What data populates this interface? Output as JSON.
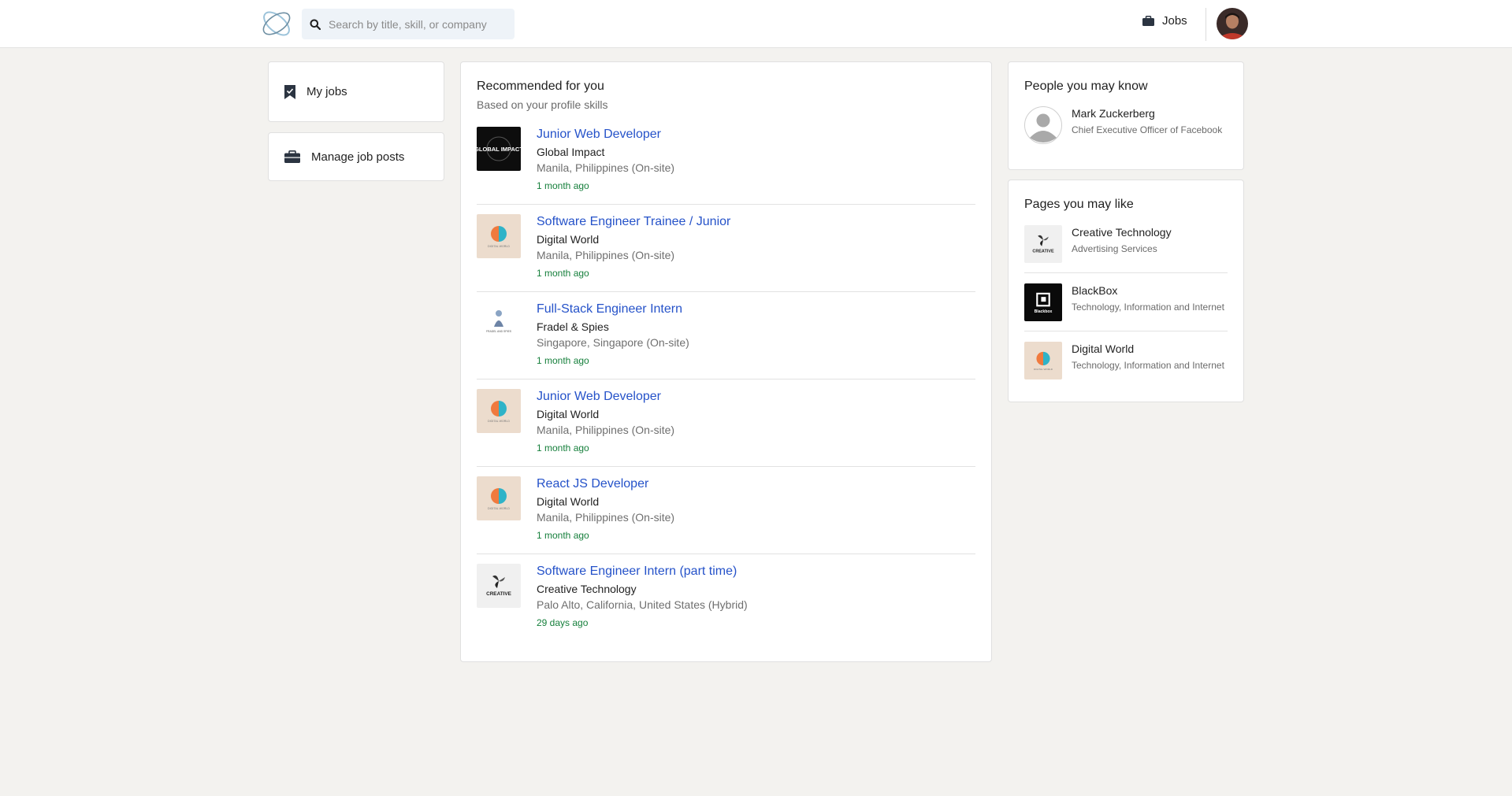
{
  "header": {
    "search_placeholder": "Search by title, skill, or company",
    "jobs_label": "Jobs"
  },
  "sidebar": {
    "my_jobs": "My jobs",
    "manage_job_posts": "Manage job posts"
  },
  "recommended": {
    "title": "Recommended for you",
    "subtitle": "Based on your profile skills",
    "jobs": [
      {
        "title": "Junior Web Developer",
        "company": "Global Impact",
        "location": "Manila, Philippines (On-site)",
        "posted": "1 month ago",
        "logo": "global-impact",
        "logo_text": "GLOBAL IMPACT"
      },
      {
        "title": "Software Engineer Trainee / Junior",
        "company": "Digital World",
        "location": "Manila, Philippines (On-site)",
        "posted": "1 month ago",
        "logo": "digital-world",
        "logo_text": "DIGITAL WORLD"
      },
      {
        "title": "Full-Stack Engineer Intern",
        "company": "Fradel & Spies",
        "location": "Singapore, Singapore (On-site)",
        "posted": "1 month ago",
        "logo": "fradel-spies",
        "logo_text": "FRADEL AND SPIES"
      },
      {
        "title": "Junior Web Developer",
        "company": "Digital World",
        "location": "Manila, Philippines (On-site)",
        "posted": "1 month ago",
        "logo": "digital-world",
        "logo_text": "DIGITAL WORLD"
      },
      {
        "title": "React JS Developer",
        "company": "Digital World",
        "location": "Manila, Philippines (On-site)",
        "posted": "1 month ago",
        "logo": "digital-world",
        "logo_text": "DIGITAL WORLD"
      },
      {
        "title": "Software Engineer Intern (part time)",
        "company": "Creative Technology",
        "location": "Palo Alto, California, United States (Hybrid)",
        "posted": "29 days ago",
        "logo": "creative-technology",
        "logo_text": "CREATIVE"
      }
    ]
  },
  "people": {
    "title": "People you may know",
    "items": [
      {
        "name": "Mark Zuckerberg",
        "headline": "Chief Executive Officer of Facebook"
      }
    ]
  },
  "pages": {
    "title": "Pages you may like",
    "items": [
      {
        "name": "Creative Technology",
        "industry": "Advertising Services",
        "logo": "creative-technology",
        "logo_text": "CREATIVE"
      },
      {
        "name": "BlackBox",
        "industry": "Technology, Information and Internet",
        "logo": "blackbox",
        "logo_text": "Blackbox"
      },
      {
        "name": "Digital World",
        "industry": "Technology, Information and Internet",
        "logo": "digital-world",
        "logo_text": "DIGITAL WORLD"
      }
    ]
  },
  "colors": {
    "link": "#2552c9",
    "posted": "#157f3b",
    "background": "#f3f2ef"
  }
}
